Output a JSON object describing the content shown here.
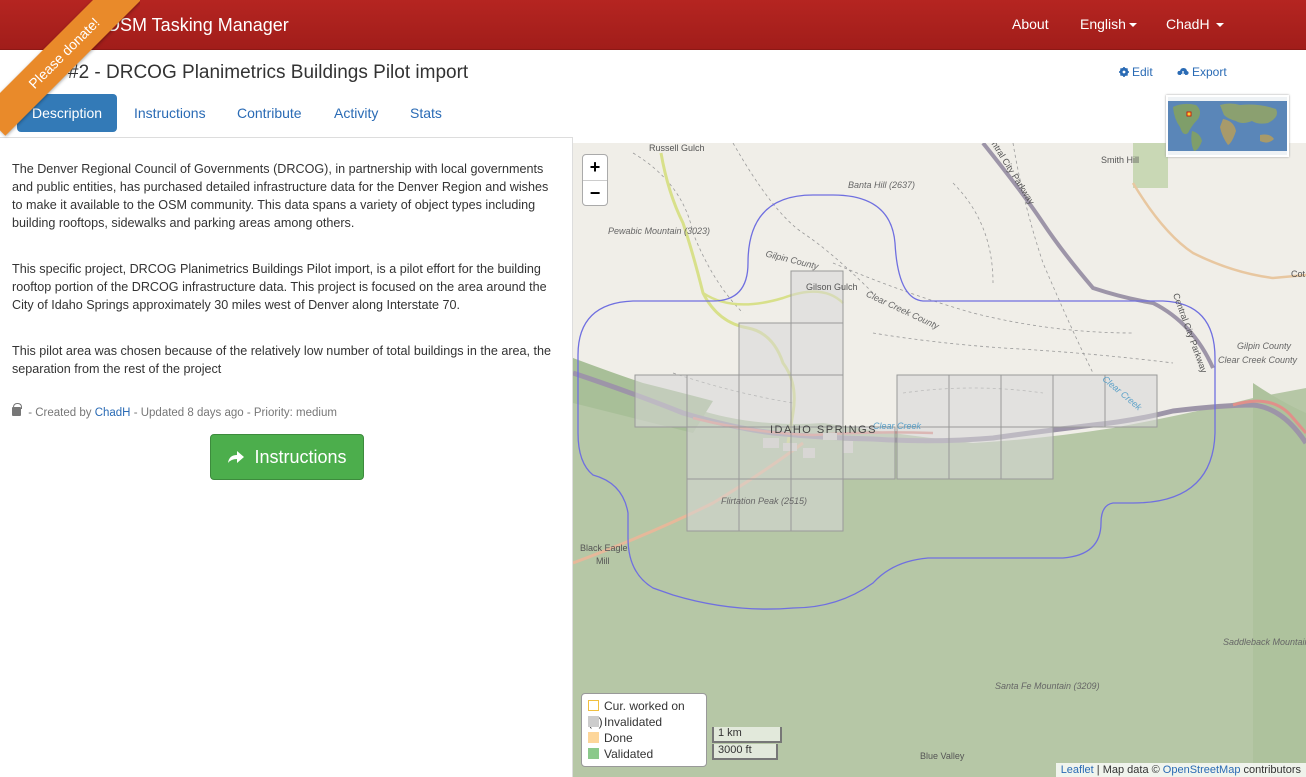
{
  "navbar": {
    "brand": "OSM Tasking Manager",
    "about": "About",
    "language": "English",
    "user": "ChadH"
  },
  "ribbon": {
    "label": "Please donate!"
  },
  "project": {
    "title": "#2 - DRCOG Planimetrics Buildings Pilot import",
    "edit_label": "Edit",
    "export_label": "Export"
  },
  "tabs": [
    {
      "label": "Description",
      "active": true
    },
    {
      "label": "Instructions",
      "active": false
    },
    {
      "label": "Contribute",
      "active": false
    },
    {
      "label": "Activity",
      "active": false
    },
    {
      "label": "Stats",
      "active": false
    }
  ],
  "description": {
    "paragraphs": [
      "The Denver Regional Council of Governments (DRCOG), in partnership with local governments and public entities, has purchased detailed infrastructure data for the Denver Region and wishes to make it available to the OSM community. This data spans a variety of object types including building rooftops, sidewalks and parking areas among others.",
      "This specific project, DRCOG Planimetrics Buildings Pilot import, is a pilot effort for the building rooftop portion of the DRCOG infrastructure data. This project is focused on the area around the City of Idaho Springs approximately 30 miles west of Denver along Interstate 70.",
      "This pilot area was chosen because of the relatively low number of total buildings in the area, the separation from the rest of the project"
    ],
    "meta_created": "- Created by",
    "meta_author": "ChadH",
    "meta_rest": "- Updated 8 days ago - Priority: medium",
    "instructions_button": "Instructions"
  },
  "map": {
    "zoom_in": "+",
    "zoom_out": "−",
    "labels": {
      "russell_gulch": "Russell Gulch",
      "smith_hill": "Smith Hill",
      "banta_hill": "Banta Hill (2637)",
      "pewabic": "Pewabic Mountain (3023)",
      "gilpin_county": "Gilpin County",
      "gilson_gulch": "Gilson Gulch",
      "clear_creek_county": "Clear Creek County",
      "central_city_parkway": "Central City Parkway",
      "central_city_parkway_2": "Central City Parkway",
      "gilpin_county_2": "Gilpin County",
      "clear_creek_county_2": "Clear Creek County",
      "clear_creek": "Clear Creek",
      "clear_creek_2": "Clear Creek",
      "idaho_springs": "IDAHO SPRINGS",
      "flirtation_peak": "Flirtation Peak (2515)",
      "black_eagle": "Black Eagle",
      "mill": "Mill",
      "saddleback": "Saddleback Mountain",
      "santa_fe": "Santa Fe Mountain (3209)",
      "blue_valley": "Blue Valley",
      "cot": "Cot"
    },
    "legend": [
      {
        "label": "Cur. worked on (0)",
        "color": "#ffffff",
        "border": "#f0c040"
      },
      {
        "label": "Invalidated",
        "color": "#cccccc",
        "border": "#cccccc"
      },
      {
        "label": "Done",
        "color": "#fdd69a",
        "border": "#fdd69a"
      },
      {
        "label": "Validated",
        "color": "#8bc98b",
        "border": "#8bc98b"
      }
    ],
    "scale_km": "1 km",
    "scale_ft": "3000 ft",
    "attribution": {
      "leaflet": "Leaflet",
      "map_data": "| Map data ©",
      "osm": "OpenStreetMap",
      "contributors": "contributors"
    }
  },
  "colors": {
    "navbar": "#a11d1a",
    "ribbon": "#e98a2a",
    "tab_active": "#337ab7",
    "button_green": "#4cae4c",
    "link": "#2a6bb5",
    "aoi_outline": "#6f6fe0"
  }
}
